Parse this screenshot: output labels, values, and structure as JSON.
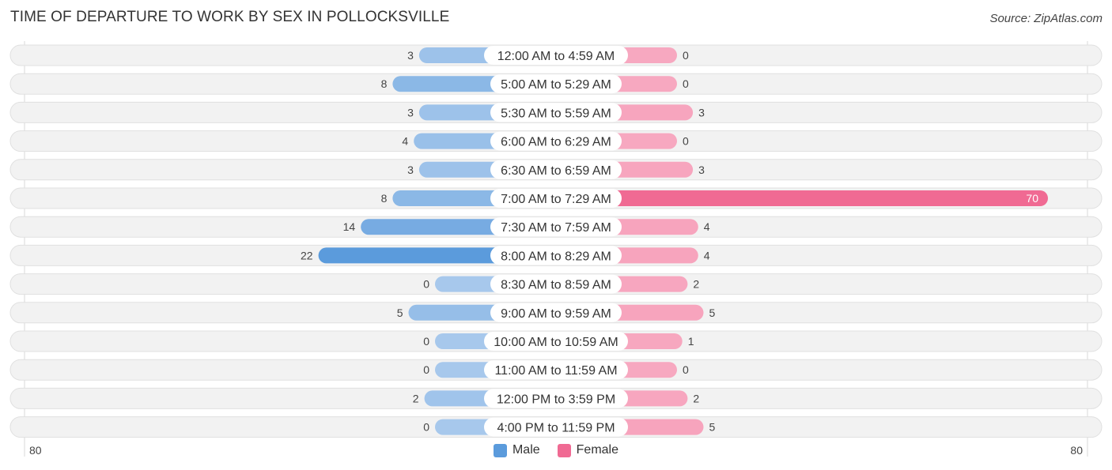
{
  "title": "TIME OF DEPARTURE TO WORK BY SEX IN POLLOCKSVILLE",
  "source": "Source: ZipAtlas.com",
  "colors": {
    "male": "#5b9bdc",
    "male_light": "#a7c8ec",
    "female": "#f06a93",
    "female_light": "#f7a8c0",
    "row_bg": "#f2f2f2"
  },
  "chart_data": {
    "type": "bar",
    "orientation": "horizontal-diverging",
    "title": "TIME OF DEPARTURE TO WORK BY SEX IN POLLOCKSVILLE",
    "categories": [
      "12:00 AM to 4:59 AM",
      "5:00 AM to 5:29 AM",
      "5:30 AM to 5:59 AM",
      "6:00 AM to 6:29 AM",
      "6:30 AM to 6:59 AM",
      "7:00 AM to 7:29 AM",
      "7:30 AM to 7:59 AM",
      "8:00 AM to 8:29 AM",
      "8:30 AM to 8:59 AM",
      "9:00 AM to 9:59 AM",
      "10:00 AM to 10:59 AM",
      "11:00 AM to 11:59 AM",
      "12:00 PM to 3:59 PM",
      "4:00 PM to 11:59 PM"
    ],
    "series": [
      {
        "name": "Male",
        "values": [
          3,
          8,
          3,
          4,
          3,
          8,
          14,
          22,
          0,
          5,
          0,
          0,
          2,
          0
        ]
      },
      {
        "name": "Female",
        "values": [
          0,
          0,
          3,
          0,
          3,
          70,
          4,
          4,
          2,
          5,
          1,
          0,
          2,
          5
        ]
      }
    ],
    "axis_min_label": "80",
    "axis_max_label": "80",
    "xlim": [
      -80,
      80
    ],
    "legend": [
      "Male",
      "Female"
    ],
    "legend_position": "bottom-center"
  }
}
